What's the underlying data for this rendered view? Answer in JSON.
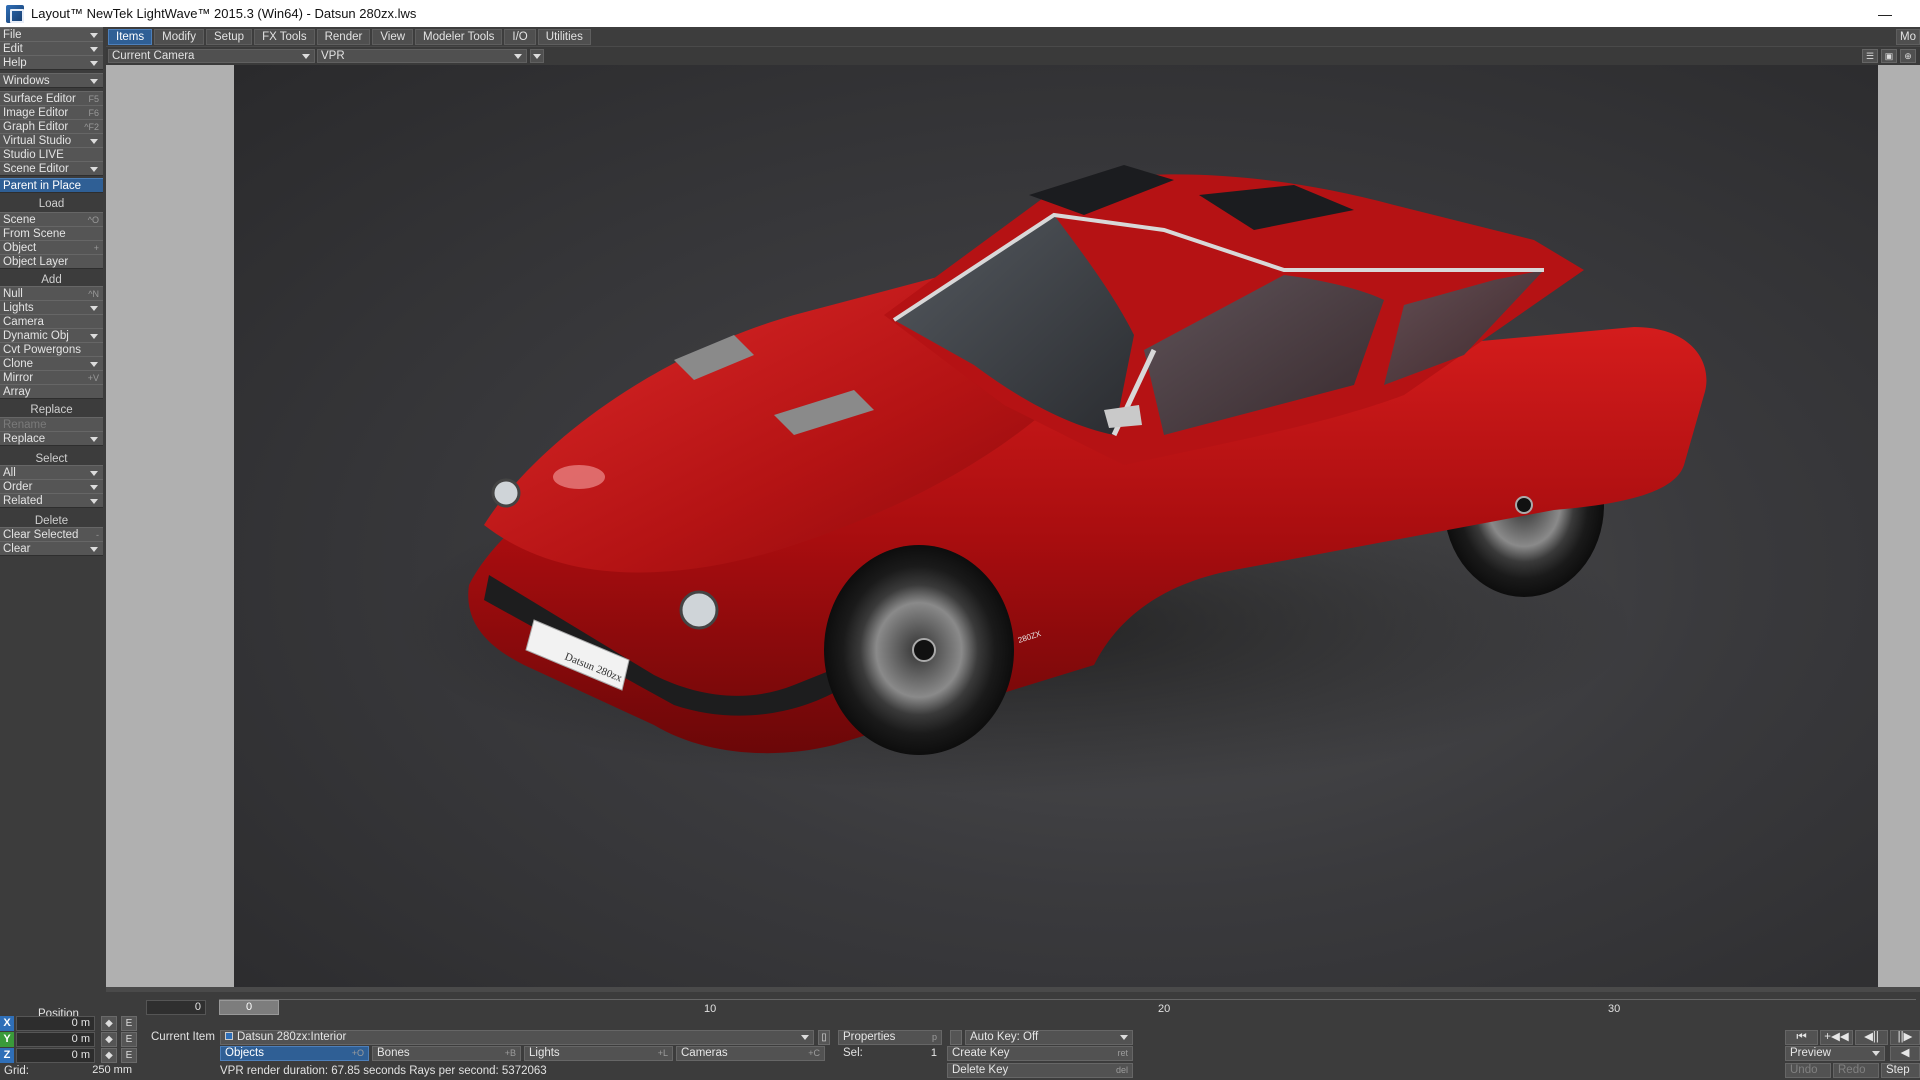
{
  "window": {
    "title": "Layout™ NewTek LightWave™ 2015.3 (Win64) - Datsun 280zx.lws",
    "minimize_glyph": "—"
  },
  "sidebar": {
    "top": [
      {
        "label": "File",
        "dropdown": true
      },
      {
        "label": "Edit",
        "dropdown": true
      },
      {
        "label": "Help",
        "dropdown": true
      },
      {
        "label": "Windows",
        "dropdown": true
      },
      {
        "label": "Surface Editor",
        "hotkey": "F5"
      },
      {
        "label": "Image Editor",
        "hotkey": "F6"
      },
      {
        "label": "Graph Editor",
        "hotkey": "^F2"
      },
      {
        "label": "Virtual Studio",
        "dropdown": true
      },
      {
        "label": "Studio LIVE"
      },
      {
        "label": "Scene Editor",
        "dropdown": true
      },
      {
        "label": "Parent in Place",
        "active": true
      }
    ],
    "load": {
      "header": "Load",
      "items": [
        {
          "label": "Scene",
          "hotkey": "^O"
        },
        {
          "label": "From Scene"
        },
        {
          "label": "Object",
          "hotkey": "+"
        },
        {
          "label": "Object Layer"
        }
      ]
    },
    "add": {
      "header": "Add",
      "items": [
        {
          "label": "Null",
          "hotkey": "^N"
        },
        {
          "label": "Lights",
          "dropdown": true
        },
        {
          "label": "Camera"
        },
        {
          "label": "Dynamic Obj",
          "dropdown": true
        },
        {
          "label": "Cvt Powergons"
        },
        {
          "label": "Clone",
          "dropdown": true
        },
        {
          "label": "Mirror",
          "hotkey": "+V"
        },
        {
          "label": "Array"
        }
      ]
    },
    "replace": {
      "header": "Replace",
      "items": [
        {
          "label": "Rename",
          "disabled": true
        },
        {
          "label": "Replace",
          "dropdown": true
        }
      ]
    },
    "select": {
      "header": "Select",
      "items": [
        {
          "label": "All",
          "dropdown": true
        },
        {
          "label": "Order",
          "dropdown": true
        },
        {
          "label": "Related",
          "dropdown": true
        }
      ]
    },
    "delete": {
      "header": "Delete",
      "items": [
        {
          "label": "Clear Selected",
          "hotkey": "-"
        },
        {
          "label": "Clear",
          "dropdown": true
        }
      ]
    }
  },
  "tabs": [
    "Items",
    "Modify",
    "Setup",
    "FX Tools",
    "Render",
    "View",
    "Modeler Tools",
    "I/O",
    "Utilities"
  ],
  "active_tab": "Items",
  "tab_overflow": "Mo",
  "viewport": {
    "camera": "Current Camera",
    "mode": "VPR",
    "icons": [
      "list-icon",
      "save-icon",
      "expand-icon"
    ],
    "car_badge": "280ZX",
    "plate": "Datsun 280zx"
  },
  "timeline": {
    "start_frame": "0",
    "thumb_frame": "0",
    "ticks": [
      "10",
      "20",
      "30"
    ]
  },
  "bottom": {
    "position_label": "Position",
    "axes": [
      {
        "axis": "X",
        "value": "0 m",
        "color": "#2f6fb8"
      },
      {
        "axis": "Y",
        "value": "0 m",
        "color": "#3a9a3a"
      },
      {
        "axis": "Z",
        "value": "0 m",
        "color": "#2f6fb8"
      }
    ],
    "e_label": "E",
    "grid_label": "Grid:",
    "grid_value": "250 mm",
    "current_item_label": "Current Item",
    "current_item": "Datsun 280zx:Interior",
    "item_types": [
      {
        "label": "Objects",
        "hotkey": "+O",
        "active": true
      },
      {
        "label": "Bones",
        "hotkey": "+B"
      },
      {
        "label": "Lights",
        "hotkey": "+L"
      },
      {
        "label": "Cameras",
        "hotkey": "+C"
      }
    ],
    "status": "VPR render duration: 67.85 seconds   Rays per second: 5372063",
    "properties": {
      "label": "Properties",
      "hotkey": "p"
    },
    "sel_label": "Sel:",
    "sel_value": "1",
    "auto_key": "Auto Key: Off",
    "create_key": {
      "label": "Create Key",
      "hotkey": "ret"
    },
    "delete_key": {
      "label": "Delete Key",
      "hotkey": "del"
    },
    "transport": [
      "⏮",
      "+◀◀",
      "◀||",
      "||▶"
    ],
    "preview": "Preview",
    "undo": "Undo",
    "redo": "Redo",
    "step": "Step"
  }
}
